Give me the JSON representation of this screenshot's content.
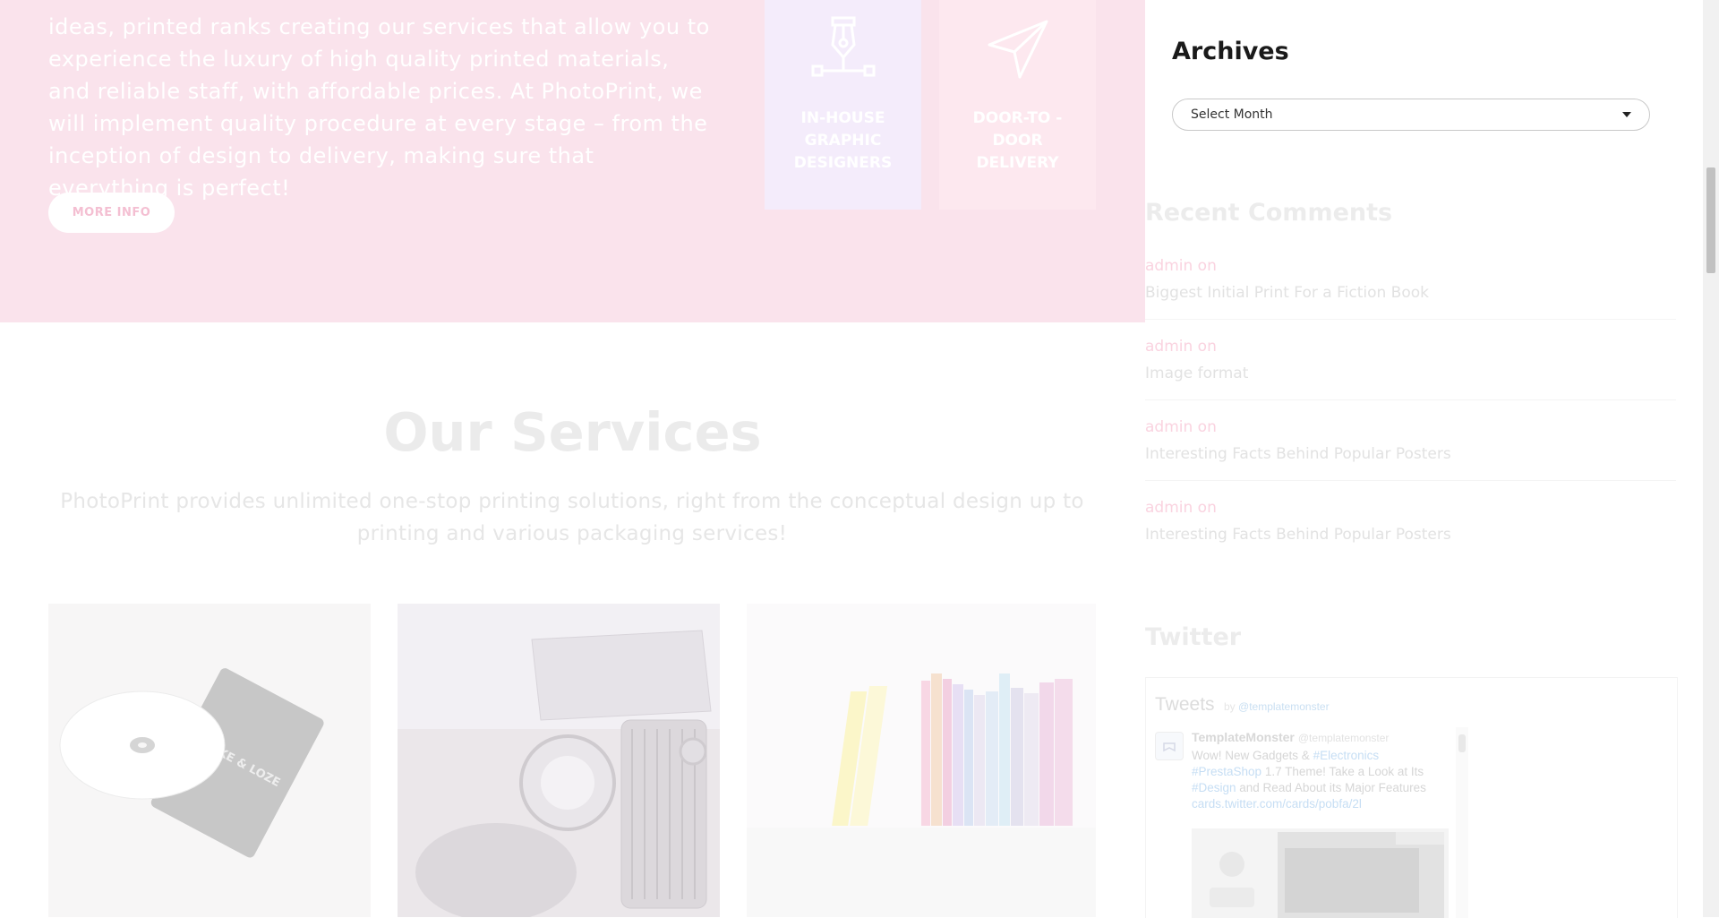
{
  "intro": {
    "text": "ideas, printed ranks creating our services that allow you to experience the luxury of high quality printed materials, and reliable staff, with affordable prices. At PhotoPrint, we will implement quality procedure at every stage – from the inception of design to delivery, making sure that everything is perfect!",
    "button_label": "MORE INFO"
  },
  "features": [
    {
      "label": "IN-HOUSE GRAPHIC DESIGNERS",
      "icon": "pen-tool-icon"
    },
    {
      "label": "DOOR-TO -DOOR DELIVERY",
      "icon": "paper-plane-icon"
    }
  ],
  "services": {
    "title": "Our Services",
    "description": "PhotoPrint provides unlimited one-stop printing solutions, right from the conceptual design up to printing and various packaging services!",
    "cards": [
      "cd-packaging-image",
      "vintage-car-image",
      "colored-books-image"
    ]
  },
  "sidebar": {
    "archives": {
      "title": "Archives",
      "select_value": "Select Month"
    },
    "recent_comments": {
      "title": "Recent Comments",
      "items": [
        {
          "author": "admin on",
          "post": "Biggest Initial Print For a Fiction Book"
        },
        {
          "author": "admin on",
          "post": "Image format"
        },
        {
          "author": "admin on",
          "post": "Interesting Facts Behind Popular Posters"
        },
        {
          "author": "admin on",
          "post": "Interesting Facts Behind Popular Posters"
        }
      ]
    },
    "twitter": {
      "title": "Twitter",
      "widget_title": "Tweets",
      "by_prefix": "by",
      "by_handle": "@templatemonster",
      "tweet": {
        "name": "TemplateMonster",
        "handle": "@templatemonster",
        "text_1": "Wow! New Gadgets & ",
        "tag_1": "#Electronics",
        "tag_2": "#PrestaShop",
        "text_2": " 1.7 Theme! Take a Look at Its ",
        "tag_3": "#Design",
        "text_3": " and Read About its Major Features ",
        "link": "cards.twitter.com/cards/pobfa/2l"
      }
    }
  },
  "colors": {
    "band": "#fae3ec",
    "feature_lavender": "#f4ecfb",
    "feature_pink": "#fde8ef",
    "accent_pink": "#fad3e0"
  }
}
